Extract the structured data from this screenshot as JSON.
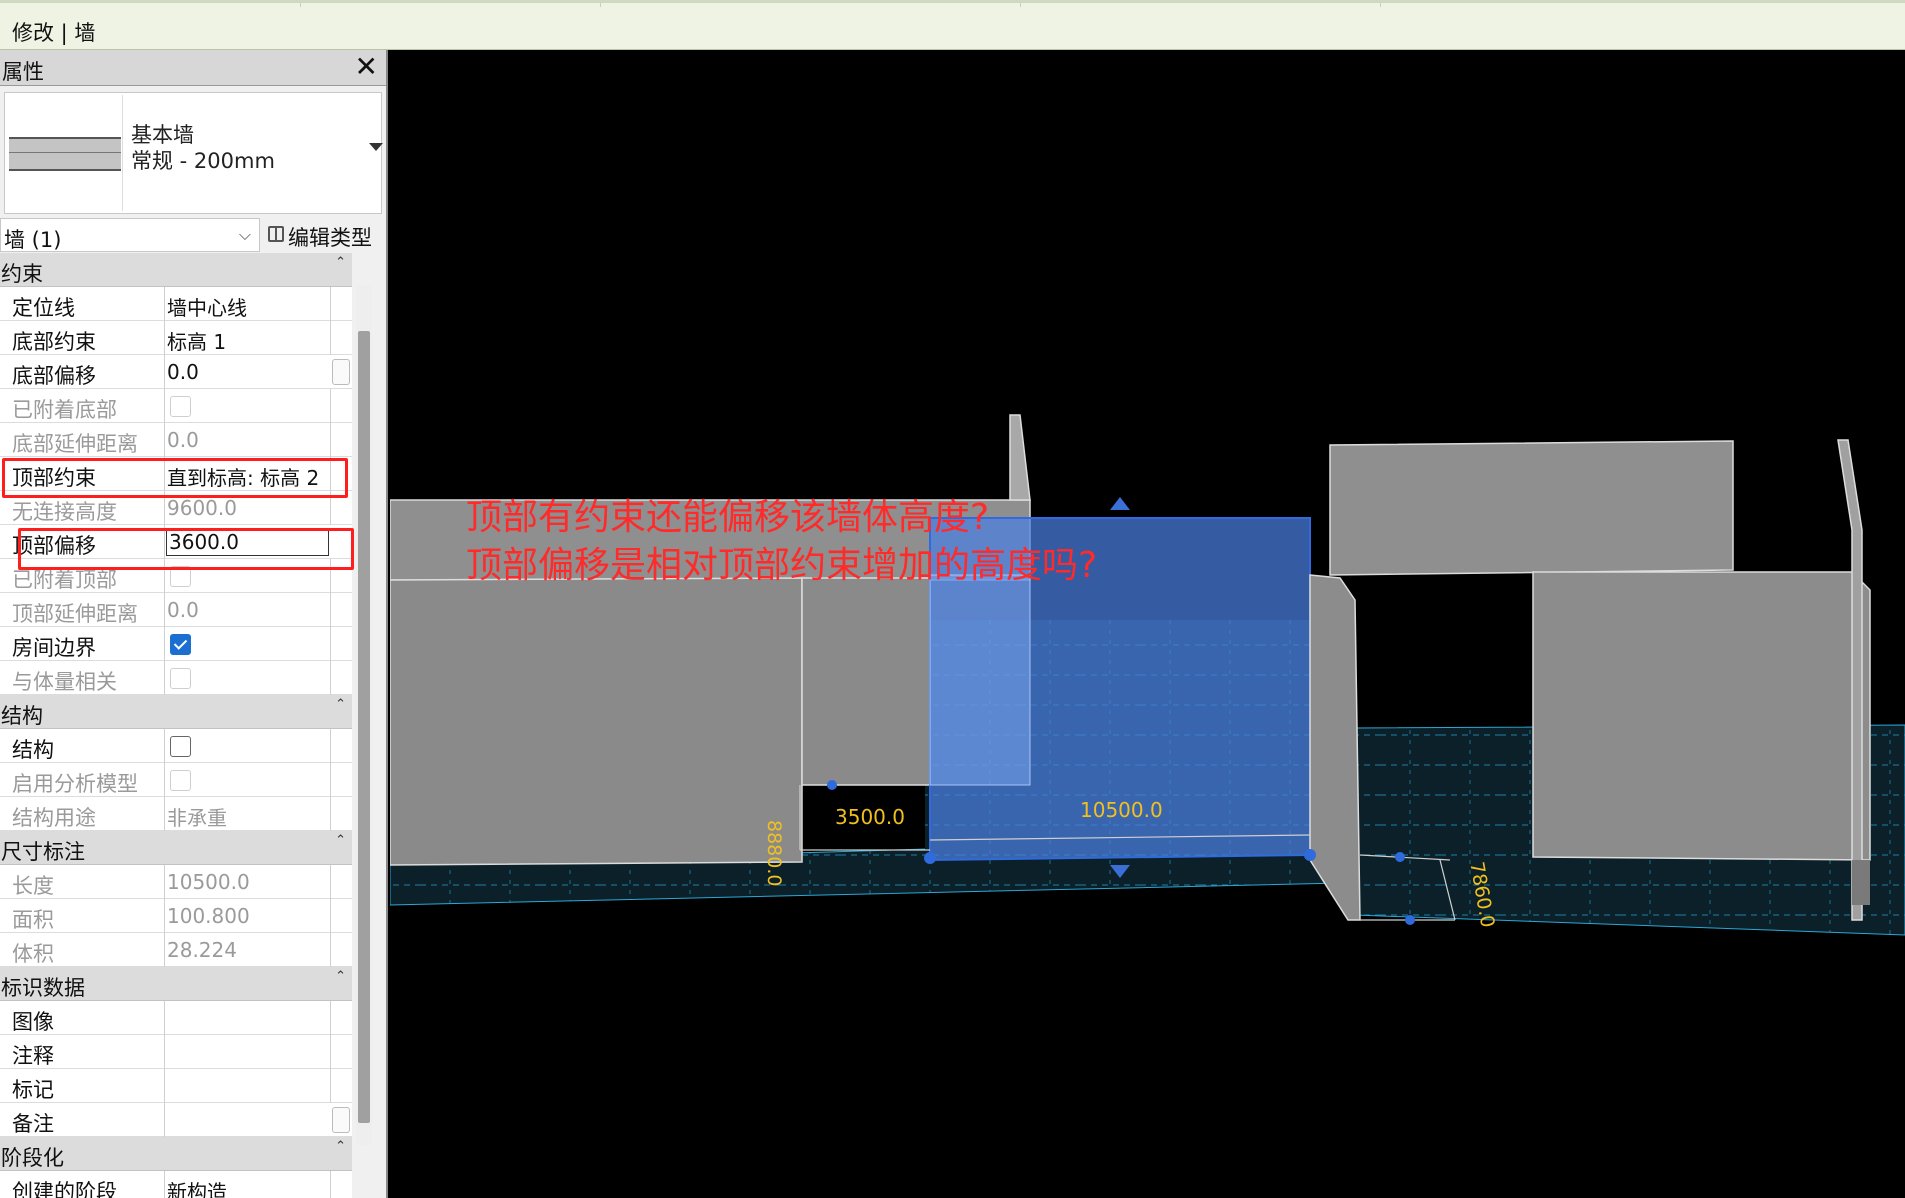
{
  "context_tab": {
    "title": "修改 | 墙"
  },
  "properties": {
    "title": "属性",
    "close": "✕",
    "type_family": "基本墙",
    "type_name": "常规 - 200mm",
    "instance_filter": "墙 (1)",
    "edit_type_label": "编辑类型",
    "groups": {
      "constraints": {
        "label": "约束",
        "rows": {
          "location_line": {
            "key": "定位线",
            "value": "墙中心线"
          },
          "base_constraint": {
            "key": "底部约束",
            "value": "标高 1"
          },
          "base_offset": {
            "key": "底部偏移",
            "value": "0.0"
          },
          "base_attached": {
            "key": "已附着底部"
          },
          "base_extension": {
            "key": "底部延伸距离",
            "value": "0.0"
          },
          "top_constraint": {
            "key": "顶部约束",
            "value": "直到标高: 标高 2"
          },
          "unconnected_height": {
            "key": "无连接高度",
            "value": "9600.0"
          },
          "top_offset": {
            "key": "顶部偏移",
            "value": "3600.0"
          },
          "top_attached": {
            "key": "已附着顶部"
          },
          "top_extension": {
            "key": "顶部延伸距离",
            "value": "0.0"
          },
          "room_bounding": {
            "key": "房间边界",
            "checked": true
          },
          "related_to_mass": {
            "key": "与体量相关"
          }
        }
      },
      "structural": {
        "label": "结构",
        "rows": {
          "structural": {
            "key": "结构"
          },
          "analytical_model": {
            "key": "启用分析模型"
          },
          "structural_usage": {
            "key": "结构用途",
            "value": "非承重"
          }
        }
      },
      "dimensions": {
        "label": "尺寸标注",
        "rows": {
          "length": {
            "key": "长度",
            "value": "10500.0"
          },
          "area": {
            "key": "面积",
            "value": "100.800"
          },
          "volume": {
            "key": "体积",
            "value": "28.224"
          }
        }
      },
      "identity": {
        "label": "标识数据",
        "rows": {
          "image": {
            "key": "图像"
          },
          "comments": {
            "key": "注释"
          },
          "mark": {
            "key": "标记"
          },
          "notes": {
            "key": "备注"
          }
        }
      },
      "phasing": {
        "label": "阶段化",
        "rows": {
          "phase_created": {
            "key": "创建的阶段",
            "value": "新构造"
          }
        }
      }
    }
  },
  "viewport": {
    "dimensions": {
      "d1": "8880.0",
      "d2": "3500.0",
      "d3": "10500.0",
      "d4": "7860.0"
    },
    "annotation": {
      "line1": "顶部有约束还能偏移该墙体高度?",
      "line2": "顶部偏移是相对顶部约束增加的高度吗?"
    }
  },
  "colors": {
    "annotation_red": "#ff1e1e",
    "selection_blue": "#4a7fe0",
    "dimension_yellow": "#f0c020",
    "wall_gray": "#8a8a8a",
    "floor_teal": "#0d2830"
  }
}
